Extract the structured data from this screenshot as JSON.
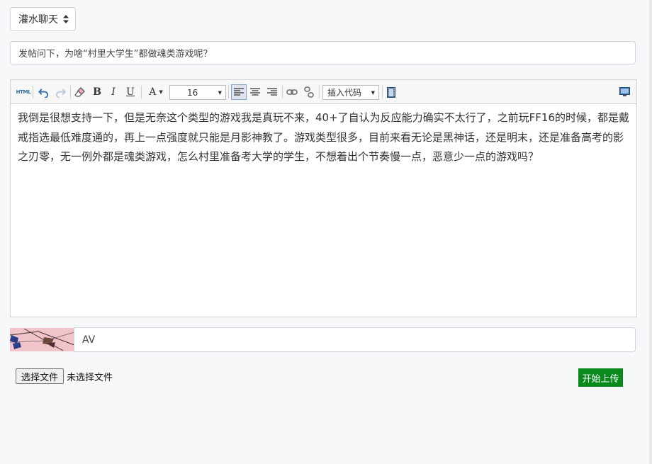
{
  "forum": {
    "selected": "灌水聊天"
  },
  "post": {
    "title": "发帖问下，为啥“村里大学生”都做魂类游戏呢？",
    "content": "我倒是很想支持一下，但是无奈这个类型的游戏我是真玩不来，40+了自认为反应能力确实不太行了，之前玩FF16的时候，都是戴戒指选最低难度通的，再上一点强度就只能是月影神教了。游戏类型很多，目前来看无论是黑神话，还是明末，还是准备高考的影之刃零，无一例外都是魂类游戏，怎么村里准备考大学的学生，不想着出个节奏慢一点，恶意少一点的游戏吗？"
  },
  "toolbar": {
    "html_label": "HTML",
    "bold_label": "B",
    "italic_label": "I",
    "underline_label": "U",
    "color_label": "A",
    "font_size": "16",
    "insert_code_label": "插入代码"
  },
  "captcha": {
    "value": "AV"
  },
  "file": {
    "button_label": "选择文件",
    "status": "未选择文件"
  },
  "upload": {
    "label": "开始上传",
    "color": "#0a8a1c"
  }
}
